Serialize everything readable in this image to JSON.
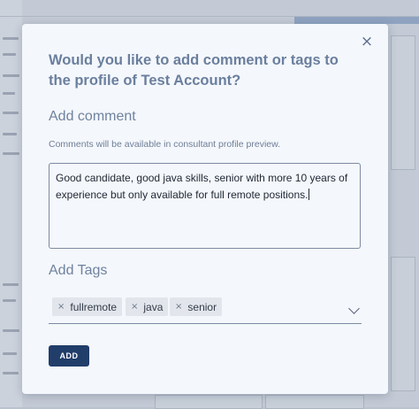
{
  "dialog": {
    "close_icon": "close-icon",
    "close_glyph": "×",
    "title": "Would you like to add comment or tags to the profile of Test Account?",
    "comment": {
      "heading": "Add comment",
      "hint": "Comments will be available in consultant profile preview.",
      "value": "Good candidate, good java skills, senior with more 10 years of experience but only available for full remote positions."
    },
    "tags": {
      "heading": "Add Tags",
      "remove_glyph": "×",
      "items": [
        {
          "label": "fullremote"
        },
        {
          "label": "java"
        },
        {
          "label": "senior"
        }
      ],
      "dropdown_icon": "chevron-down-icon"
    },
    "add_button": "ADD"
  },
  "colors": {
    "accent": "#213d6a",
    "title": "#6a7f9e",
    "dialog_bg": "#f4f7fb",
    "overlay": "#c3cad5"
  }
}
